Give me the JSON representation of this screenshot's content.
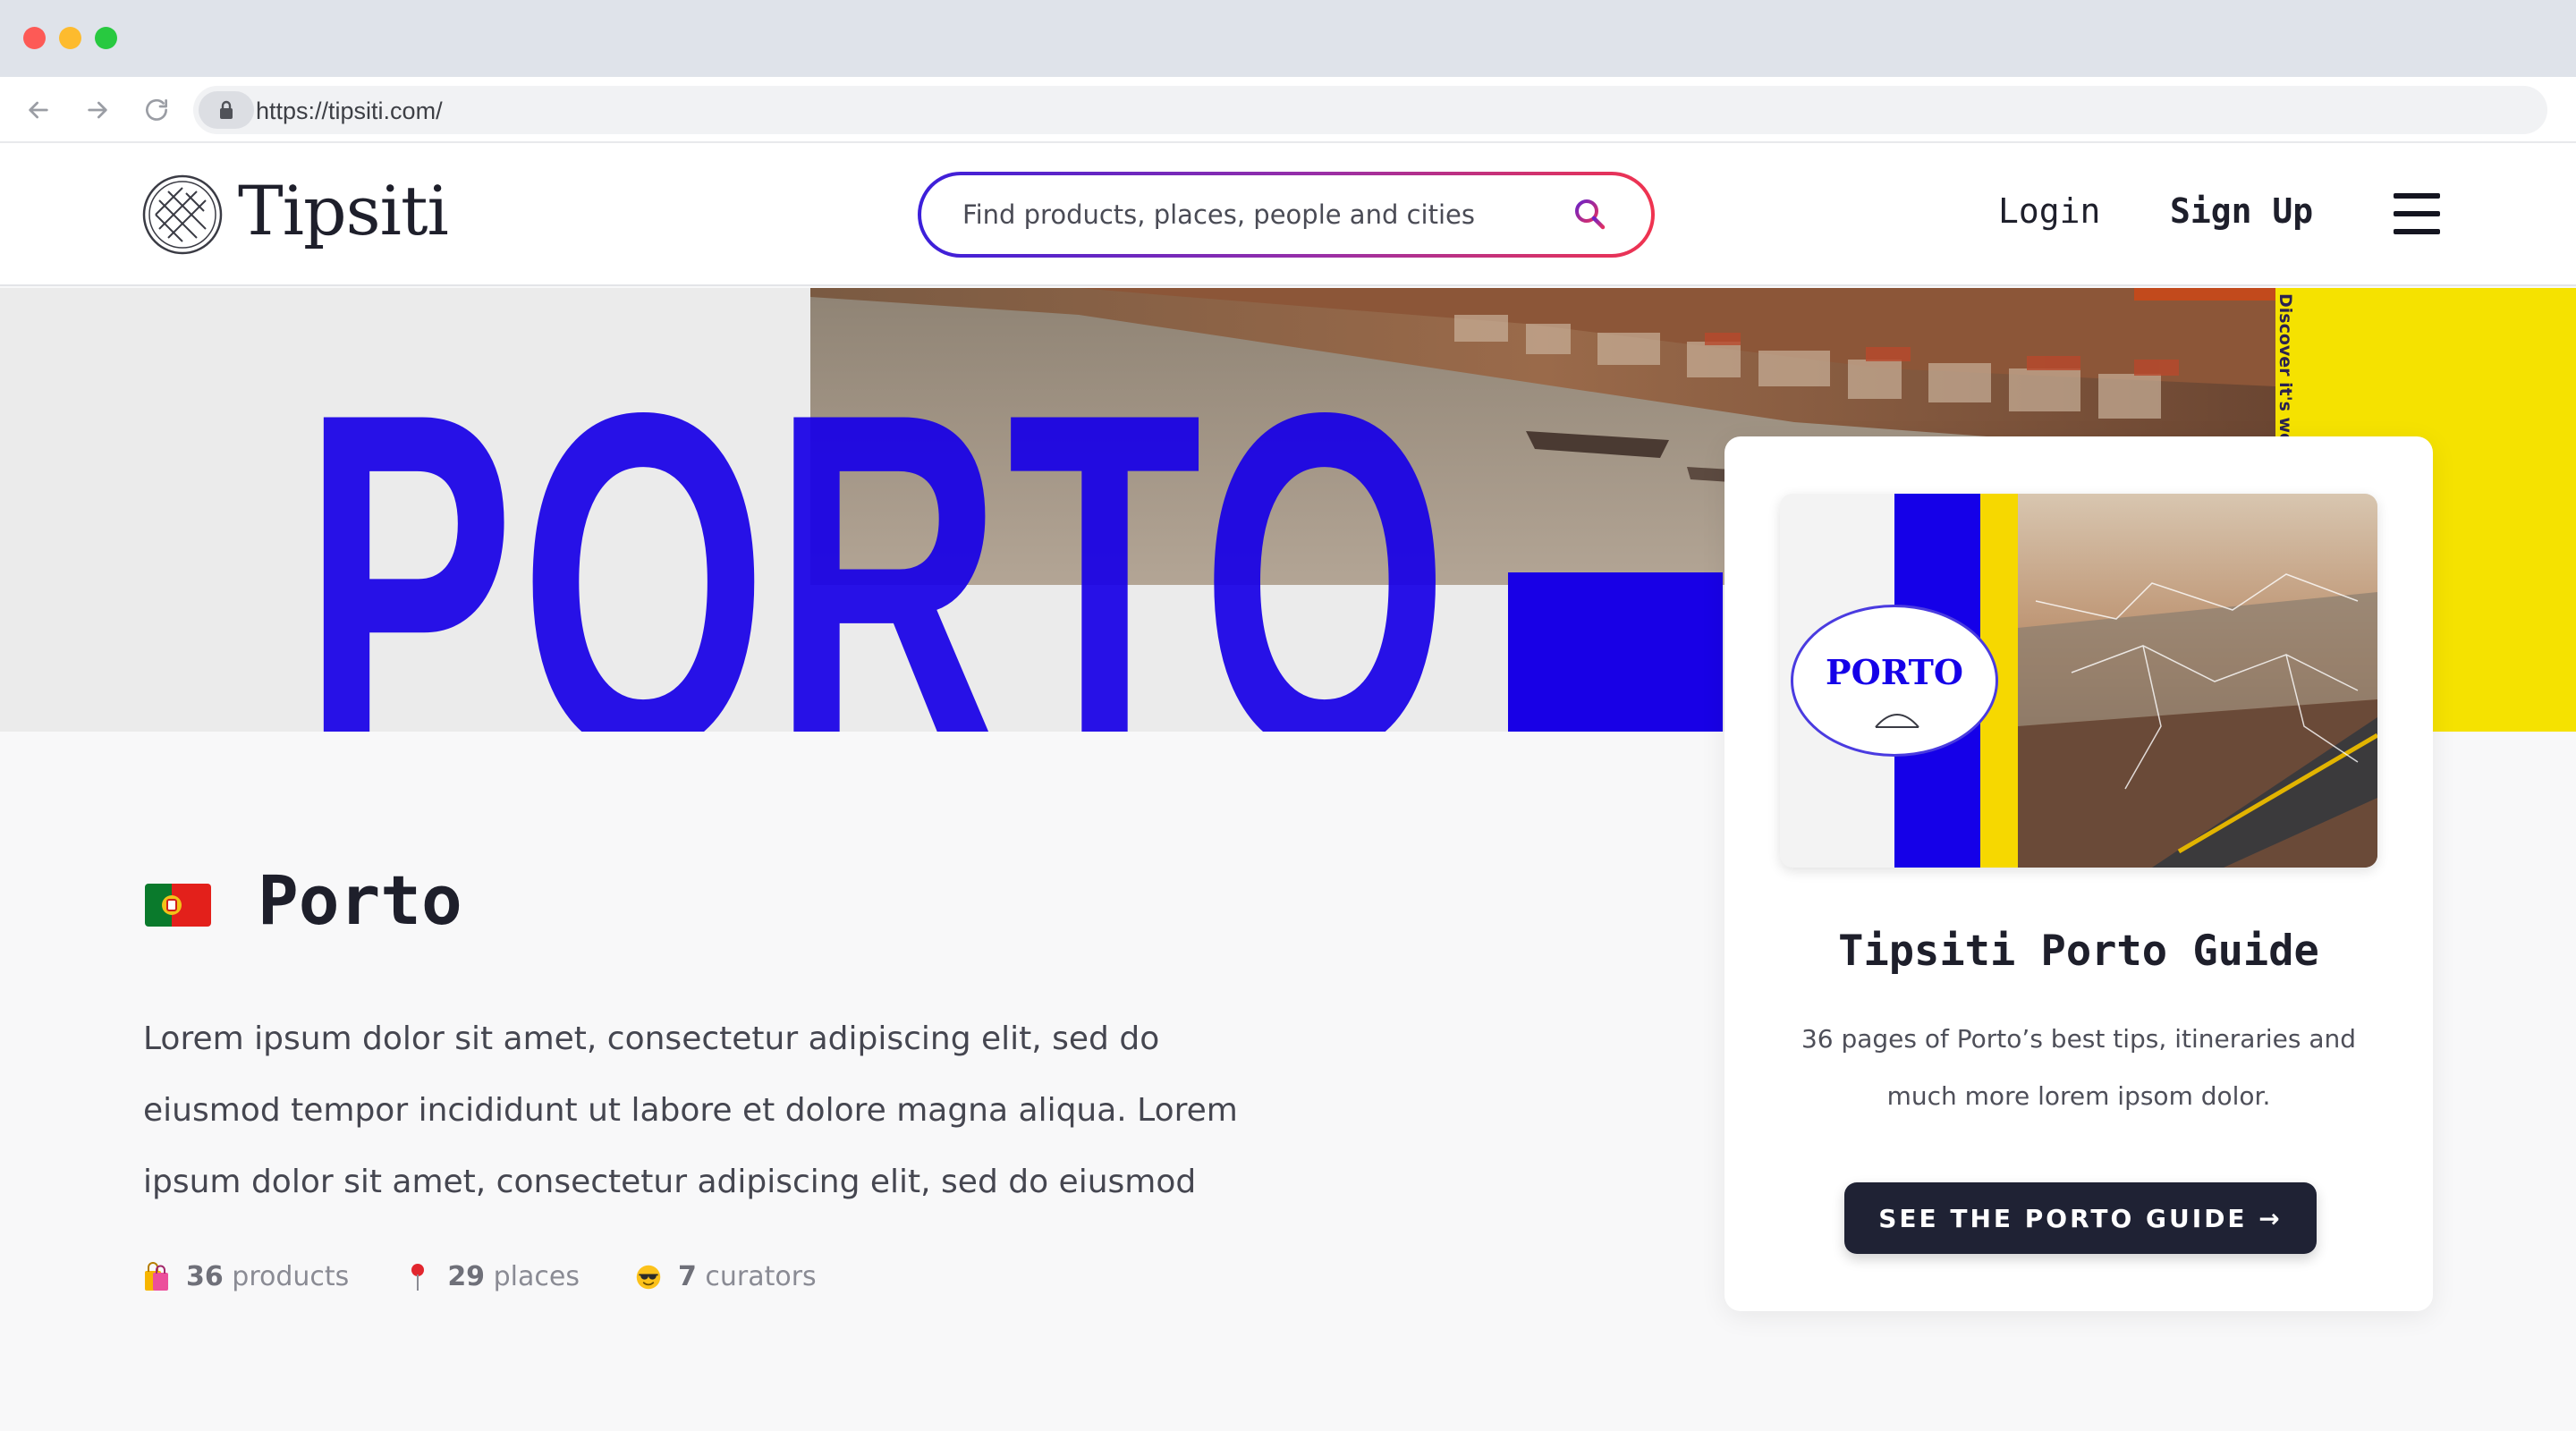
{
  "browser": {
    "url": "https://tipsiti.com/"
  },
  "header": {
    "logo_text": "Tipsiti",
    "search_placeholder": "Find products, places, people and cities",
    "login_label": "Login",
    "signup_label": "Sign Up",
    "icons": [
      "tipsiti-logo-icon",
      "search-icon",
      "hamburger-menu-icon"
    ]
  },
  "hero": {
    "big_word": "PORTO",
    "tagline": "Discover it's wonderful",
    "colors": {
      "blue": "#1800e6",
      "yellow": "#f5e200"
    }
  },
  "city": {
    "flag": "portugal-flag-icon",
    "name": "Porto",
    "description": "Lorem ipsum dolor sit amet, consectetur adipiscing elit, sed do eiusmod tempor incididunt ut labore et dolore magna aliqua. Lorem ipsum dolor sit amet, consectetur adipiscing elit, sed do eiusmod",
    "stats": [
      {
        "icon": "shopping-bags-icon",
        "count": "36",
        "label": "products"
      },
      {
        "icon": "map-pin-icon",
        "count": "29",
        "label": "places"
      },
      {
        "icon": "sunglasses-face-icon",
        "count": "7",
        "label": "curators"
      }
    ]
  },
  "guide": {
    "cover_title": "PORTO",
    "title": "Tipsiti Porto Guide",
    "description": "36 pages of Porto’s best tips, itineraries and much more lorem ipsom dolor.",
    "button_label": "SEE THE PORTO GUIDE →",
    "colors": {
      "button": "#1f2234"
    }
  }
}
